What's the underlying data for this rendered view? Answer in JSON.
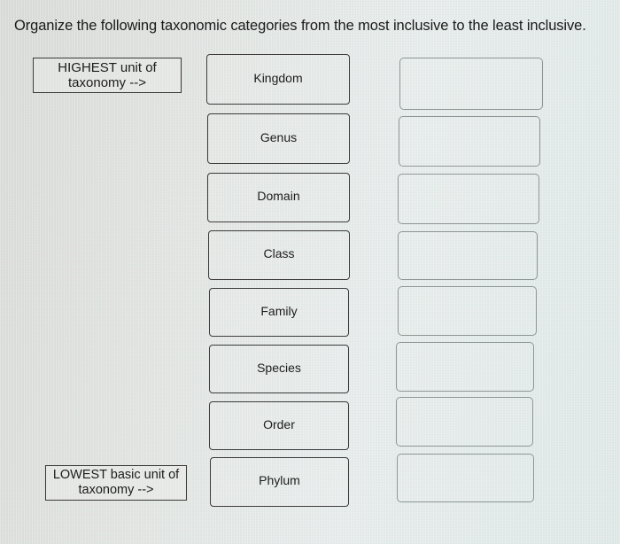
{
  "question": {
    "text": "Organize the following taxonomic categories from the most inclusive to the least inclusive."
  },
  "anchors": {
    "highest": {
      "line1": "HIGHEST unit of",
      "line2": "taxonomy -->"
    },
    "lowest": {
      "line1": "LOWEST basic unit of",
      "line2": "taxonomy -->"
    }
  },
  "tiles": [
    {
      "label": "Kingdom"
    },
    {
      "label": "Genus"
    },
    {
      "label": "Domain"
    },
    {
      "label": "Class"
    },
    {
      "label": "Family"
    },
    {
      "label": "Species"
    },
    {
      "label": "Order"
    },
    {
      "label": "Phylum"
    }
  ],
  "slots": [
    {
      "value": ""
    },
    {
      "value": ""
    },
    {
      "value": ""
    },
    {
      "value": ""
    },
    {
      "value": ""
    },
    {
      "value": ""
    },
    {
      "value": ""
    },
    {
      "value": ""
    }
  ]
}
